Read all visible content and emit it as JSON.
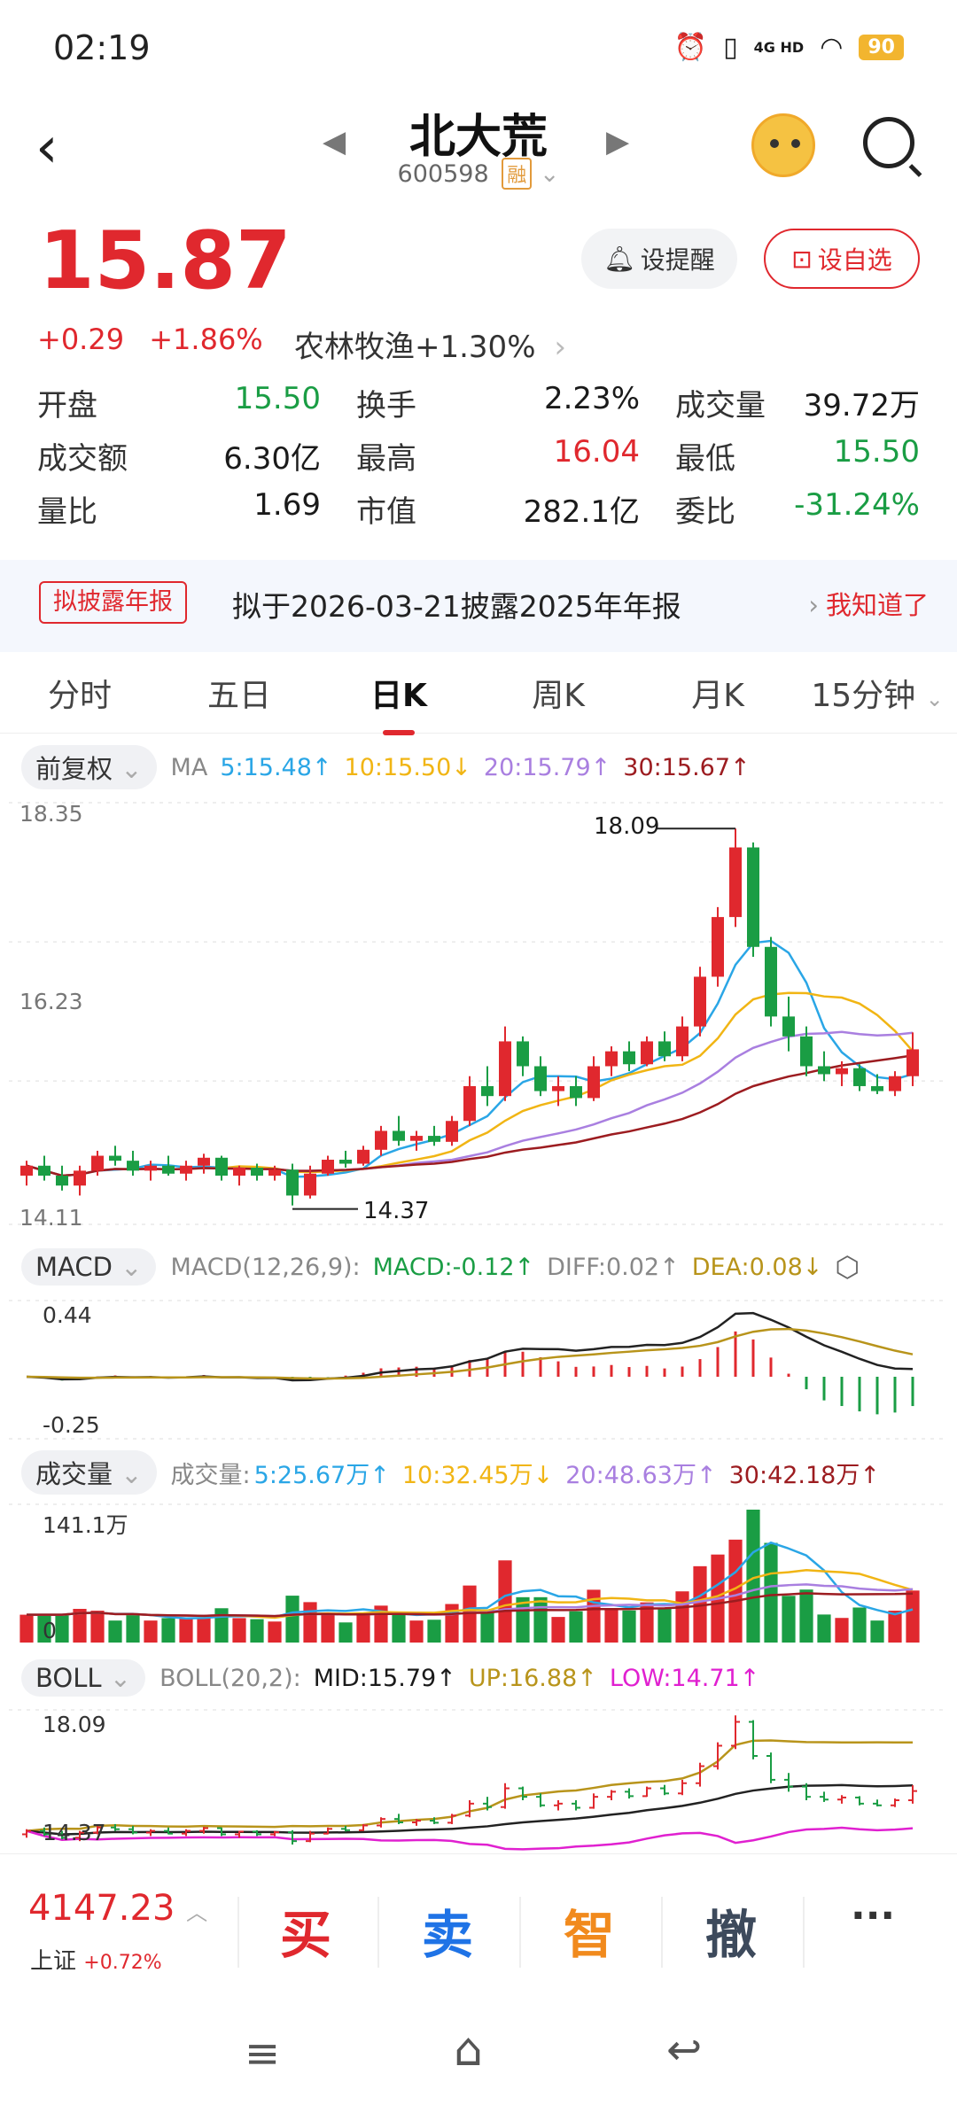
{
  "status_bar": {
    "time": "02:19",
    "network": "4G HD",
    "battery": "90"
  },
  "header": {
    "title": "北大荒",
    "code": "600598",
    "tag": "融"
  },
  "quote": {
    "price": "15.87",
    "change": "+0.29",
    "change_pct": "+1.86%",
    "industry": "农林牧渔",
    "industry_pct": "+1.30%",
    "remind_label": "设提醒",
    "fav_label": "设自选"
  },
  "stats": [
    [
      {
        "label": "开盘",
        "value": "15.50",
        "color": "green"
      },
      {
        "label": "换手",
        "value": "2.23%",
        "color": "plain"
      },
      {
        "label": "成交量",
        "value": "39.72万",
        "color": "plain"
      }
    ],
    [
      {
        "label": "成交额",
        "value": "6.30亿",
        "color": "plain"
      },
      {
        "label": "最高",
        "value": "16.04",
        "color": "red"
      },
      {
        "label": "最低",
        "value": "15.50",
        "color": "green"
      }
    ],
    [
      {
        "label": "量比",
        "value": "1.69",
        "color": "plain"
      },
      {
        "label": "市值",
        "value": "282.1亿",
        "color": "plain"
      },
      {
        "label": "委比",
        "value": "-31.24%",
        "color": "green"
      }
    ]
  ],
  "notice": {
    "tag": "拟披露年报",
    "text": "拟于2026-03-21披露2025年年报",
    "action": "我知道了"
  },
  "tabs": [
    "分时",
    "五日",
    "日K",
    "周K",
    "月K",
    "15分钟"
  ],
  "active_tab": "日K",
  "main_chart": {
    "adjust": "前复权",
    "ma_title": "MA",
    "ma": [
      {
        "label": "5:15.48↑",
        "color": "#2aa6e6"
      },
      {
        "label": "10:15.50↓",
        "color": "#f1b514"
      },
      {
        "label": "20:15.79↑",
        "color": "#a97fe0"
      },
      {
        "label": "30:15.67↑",
        "color": "#9c1c20"
      }
    ],
    "y_top": "18.35",
    "y_mid": "16.23",
    "y_bottom": "14.11",
    "high_label": "18.09",
    "low_label": "14.37"
  },
  "macd": {
    "name": "MACD",
    "params": "MACD(12,26,9):",
    "macd": "MACD:-0.12↑",
    "diff": "DIFF:0.02↑",
    "dea": "DEA:0.08↓",
    "y_top": "0.44",
    "y_bottom": "-0.25"
  },
  "volume": {
    "name": "成交量",
    "title": "成交量:",
    "ma": [
      {
        "label": "5:25.67万↑",
        "color": "#2aa6e6"
      },
      {
        "label": "10:32.45万↓",
        "color": "#f1b514"
      },
      {
        "label": "20:48.63万↑",
        "color": "#a97fe0"
      },
      {
        "label": "30:42.18万↑",
        "color": "#9c1c20"
      }
    ],
    "y_top": "141.1万",
    "y_zero": "0"
  },
  "boll": {
    "name": "BOLL",
    "params": "BOLL(20,2):",
    "mid": "MID:15.79↑",
    "up": "UP:16.88↑",
    "low": "LOW:14.71↑",
    "y_top": "18.09",
    "y_bottom": "14.37"
  },
  "bottom_bar": {
    "index_value": "4147.23",
    "index_name": "上证",
    "index_pct": "+0.72%",
    "buy": "买",
    "sell": "卖",
    "smart": "智",
    "cancel": "撤",
    "more": "···"
  },
  "colors": {
    "up": "#e0282e",
    "down": "#1a9d44",
    "accent": "#e0282e"
  },
  "chart_data": {
    "type": "candlestick",
    "ohlc_approx": [
      [
        14.6,
        14.75,
        14.5,
        14.7
      ],
      [
        14.7,
        14.8,
        14.55,
        14.6
      ],
      [
        14.6,
        14.7,
        14.45,
        14.5
      ],
      [
        14.5,
        14.7,
        14.4,
        14.65
      ],
      [
        14.65,
        14.85,
        14.6,
        14.8
      ],
      [
        14.8,
        14.9,
        14.7,
        14.75
      ],
      [
        14.75,
        14.85,
        14.6,
        14.65
      ],
      [
        14.65,
        14.75,
        14.55,
        14.7
      ],
      [
        14.7,
        14.8,
        14.6,
        14.62
      ],
      [
        14.62,
        14.75,
        14.55,
        14.7
      ],
      [
        14.7,
        14.82,
        14.62,
        14.78
      ],
      [
        14.78,
        14.8,
        14.55,
        14.6
      ],
      [
        14.6,
        14.7,
        14.5,
        14.68
      ],
      [
        14.68,
        14.72,
        14.55,
        14.6
      ],
      [
        14.6,
        14.7,
        14.55,
        14.66
      ],
      [
        14.66,
        14.72,
        14.3,
        14.4
      ],
      [
        14.4,
        14.7,
        14.37,
        14.62
      ],
      [
        14.62,
        14.8,
        14.6,
        14.76
      ],
      [
        14.76,
        14.85,
        14.68,
        14.72
      ],
      [
        14.72,
        14.9,
        14.7,
        14.86
      ],
      [
        14.86,
        15.1,
        14.8,
        15.05
      ],
      [
        15.05,
        15.2,
        14.9,
        14.95
      ],
      [
        14.95,
        15.05,
        14.85,
        15.0
      ],
      [
        15.0,
        15.1,
        14.9,
        14.94
      ],
      [
        14.94,
        15.2,
        14.9,
        15.15
      ],
      [
        15.15,
        15.6,
        15.1,
        15.5
      ],
      [
        15.5,
        15.7,
        15.3,
        15.4
      ],
      [
        15.4,
        16.1,
        15.35,
        15.95
      ],
      [
        15.95,
        16.0,
        15.6,
        15.7
      ],
      [
        15.7,
        15.8,
        15.4,
        15.45
      ],
      [
        15.45,
        15.6,
        15.3,
        15.5
      ],
      [
        15.5,
        15.6,
        15.3,
        15.38
      ],
      [
        15.38,
        15.8,
        15.35,
        15.7
      ],
      [
        15.7,
        15.9,
        15.6,
        15.85
      ],
      [
        15.85,
        15.95,
        15.65,
        15.72
      ],
      [
        15.72,
        16.0,
        15.7,
        15.95
      ],
      [
        15.95,
        16.05,
        15.75,
        15.8
      ],
      [
        15.8,
        16.2,
        15.75,
        16.1
      ],
      [
        16.1,
        16.7,
        16.0,
        16.6
      ],
      [
        16.6,
        17.3,
        16.5,
        17.2
      ],
      [
        17.2,
        18.09,
        17.1,
        17.9
      ],
      [
        17.9,
        17.95,
        16.8,
        16.9
      ],
      [
        16.9,
        17.0,
        16.1,
        16.2
      ],
      [
        16.2,
        16.4,
        15.85,
        16.0
      ],
      [
        16.0,
        16.1,
        15.6,
        15.7
      ],
      [
        15.7,
        15.85,
        15.55,
        15.62
      ],
      [
        15.62,
        15.75,
        15.5,
        15.68
      ],
      [
        15.68,
        15.72,
        15.45,
        15.5
      ],
      [
        15.5,
        15.62,
        15.42,
        15.45
      ],
      [
        15.45,
        15.65,
        15.4,
        15.6
      ],
      [
        15.6,
        16.04,
        15.5,
        15.87
      ]
    ]
  }
}
